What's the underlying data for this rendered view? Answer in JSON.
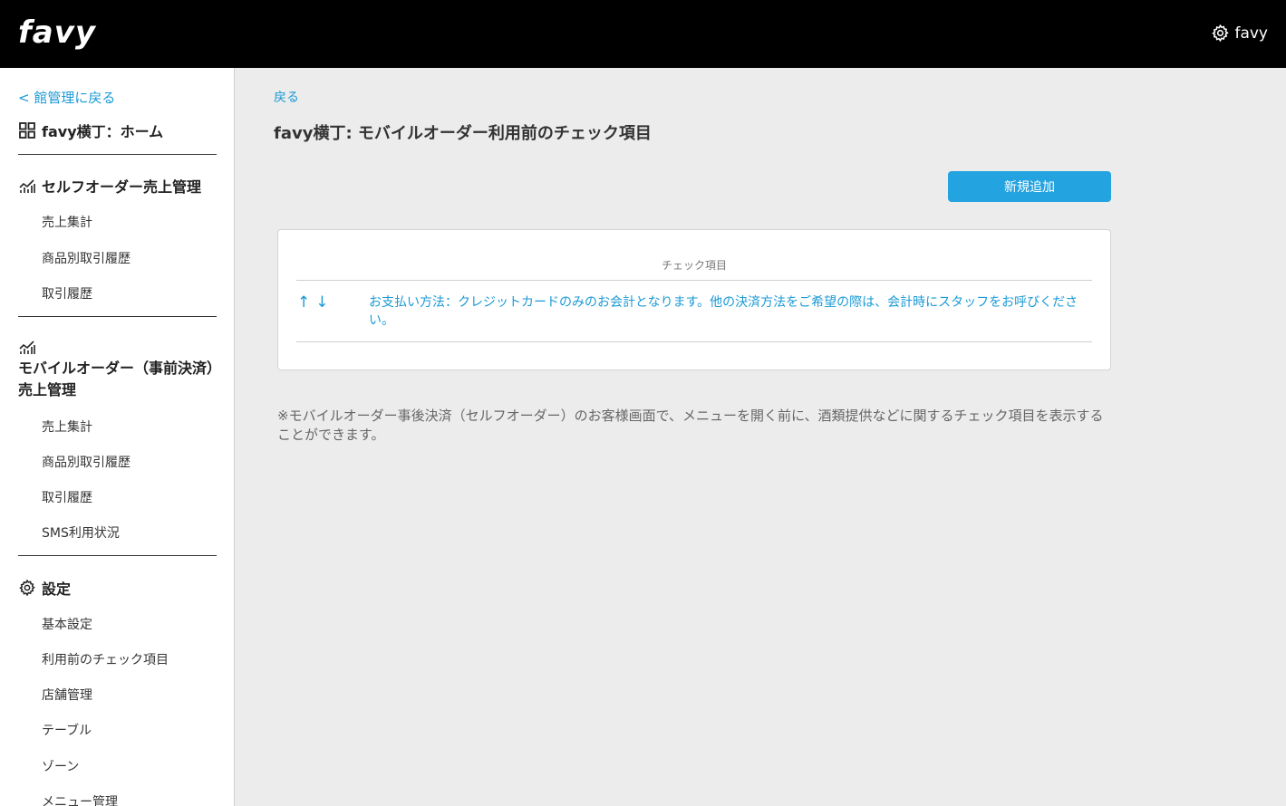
{
  "header": {
    "logo": "favy",
    "account_label": "favy",
    "account_icon": "gear-icon"
  },
  "sidebar": {
    "back_link": "< 館管理に戻る",
    "home": {
      "label": "favy横丁：ホーム",
      "icon": "grid-icon"
    },
    "self_order": {
      "title": "セルフオーダー売上管理",
      "icon": "chart-icon",
      "items": [
        "売上集計",
        "商品別取引履歴",
        "取引履歴"
      ]
    },
    "mobile_order": {
      "title": "モバイルオーダー（事前決済）売上管理",
      "icon": "chart-icon",
      "items": [
        "売上集計",
        "商品別取引履歴",
        "取引履歴",
        "SMS利用状況"
      ]
    },
    "settings": {
      "title": "設定",
      "icon": "gear-icon",
      "items": [
        "基本設定",
        "利用前のチェック項目",
        "店舗管理",
        "テーブル",
        "ゾーン",
        "メニュー管理"
      ]
    }
  },
  "main": {
    "back_link": "戻る",
    "title": "favy横丁: モバイルオーダー利用前のチェック項目",
    "add_button": "新規追加",
    "table": {
      "column_header": "チェック項目",
      "rows": [
        {
          "up_arrow": "↑",
          "down_arrow": "↓",
          "text": "お支払い方法：クレジットカードのみのお会計となります。他の決済方法をご希望の際は、会計時にスタッフをお呼びください。"
        }
      ]
    },
    "note": "※モバイルオーダー事後決済（セルフオーダー）のお客様画面で、メニューを開く前に、酒類提供などに関するチェック項目を表示することができます。"
  },
  "colors": {
    "accent": "#1a9ad6",
    "button": "#23a3e0",
    "header_bg": "#000000",
    "content_bg": "#ececec"
  }
}
